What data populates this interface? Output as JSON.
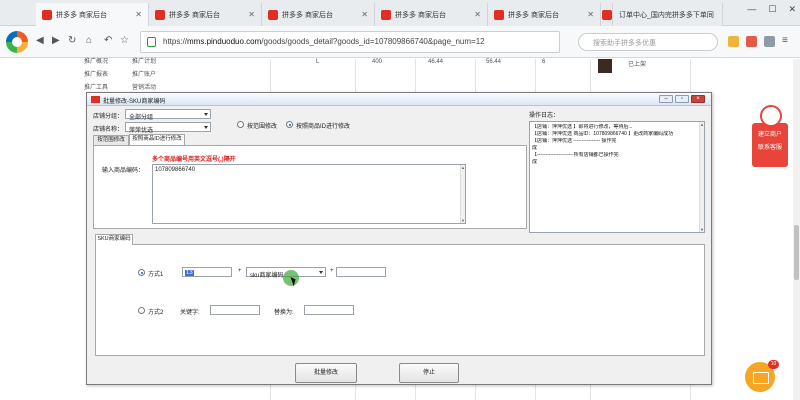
{
  "browser": {
    "tabs": [
      {
        "label": "拼多多 商家后台"
      },
      {
        "label": "拼多多 商家后台"
      },
      {
        "label": "拼多多 商家后台"
      },
      {
        "label": "拼多多 商家后台"
      },
      {
        "label": "拼多多 商家后台"
      },
      {
        "label": "拼多多 商家后台"
      },
      {
        "label": "订单中心_国内完拼多多下单同"
      }
    ],
    "url_scheme": "https://",
    "url_host": "mms.pinduoduo.com",
    "url_path": "/goods/goods_detail?goods_id=107809866740&page_num=12",
    "search_placeholder": "搜索助手拼多多优惠"
  },
  "background_page": {
    "menu": [
      "推广概况",
      "推广计划",
      "推广报表",
      "推广账户",
      "推广工具",
      "营销活动"
    ],
    "row_top": [
      "L",
      "400",
      "46.44",
      "56.44",
      "6",
      "已上架"
    ],
    "side_float": {
      "line1": "建立商户",
      "line2": "联系客服"
    },
    "mail_badge": "10"
  },
  "dialog": {
    "title": "批量修改-SKU商家编码",
    "shop_group_label": "店铺分组：",
    "shop_group_value": "全部分组",
    "shop_name_label": "店铺名称：",
    "shop_name_value": "萍萍优选",
    "radio_by_scope": "按范围修改",
    "radio_by_id": "按照商品ID进行修改",
    "tabs": [
      "按范围修改",
      "按照商品ID进行修改"
    ],
    "hint": "多个商品编号用英文逗号(,)隔开",
    "input_label": "输入商品编码：",
    "input_value": "107809866740",
    "log_title": "操作日志：",
    "log_lines": [
      "【店铺：萍萍优选 】即将进行修改，等待后...",
      "【店铺：萍萍优选 商品ID：107809866740 】更改商家编码成功",
      "【店铺：萍萍优选 ---------------- 操作完",
      "成",
      "【----------------------所有店铺都已操作完",
      "成"
    ],
    "sku_tab": "SKU商家编码",
    "mode1_label": "方式1",
    "mode1_input": "13",
    "mode1_select": "sku商家编码",
    "mode2_label": "方式2",
    "keyword_label": "关键字:",
    "replace_label": "替换为:",
    "batch_button": "批量修改",
    "stop_button": "停止"
  }
}
